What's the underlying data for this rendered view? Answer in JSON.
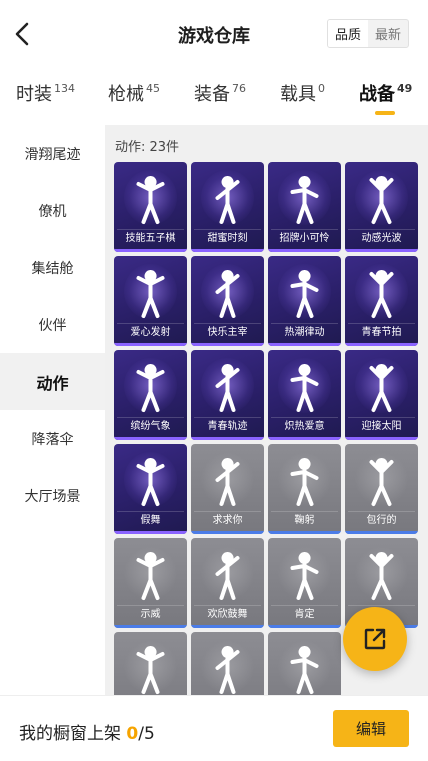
{
  "header": {
    "title": "游戏仓库",
    "sort_options": [
      "品质",
      "最新"
    ],
    "sort_active": "品质"
  },
  "tabs": [
    {
      "label": "时装",
      "count": "134"
    },
    {
      "label": "枪械",
      "count": "45"
    },
    {
      "label": "装备",
      "count": "76"
    },
    {
      "label": "载具",
      "count": "0"
    },
    {
      "label": "战备",
      "count": "49",
      "active": true
    }
  ],
  "sidebar": {
    "items": [
      "滑翔尾迹",
      "僚机",
      "集结舱",
      "伙伴",
      "动作",
      "降落伞",
      "大厅场景"
    ],
    "active": "动作"
  },
  "main": {
    "count_label": "动作: 23件",
    "items": [
      {
        "name": "技能五子棋",
        "tier": "purple"
      },
      {
        "name": "甜蜜时刻",
        "tier": "purple"
      },
      {
        "name": "招牌小可怜",
        "tier": "purple"
      },
      {
        "name": "动感光波",
        "tier": "purple"
      },
      {
        "name": "爱心发射",
        "tier": "purple"
      },
      {
        "name": "快乐主宰",
        "tier": "purple"
      },
      {
        "name": "热潮律动",
        "tier": "purple"
      },
      {
        "name": "青春节拍",
        "tier": "purple"
      },
      {
        "name": "缤纷气象",
        "tier": "purple"
      },
      {
        "name": "青春轨迹",
        "tier": "purple"
      },
      {
        "name": "炽热爱意",
        "tier": "purple"
      },
      {
        "name": "迎接太阳",
        "tier": "purple"
      },
      {
        "name": "假舞",
        "tier": "purple"
      },
      {
        "name": "求求你",
        "tier": "gray"
      },
      {
        "name": "鞠躬",
        "tier": "gray"
      },
      {
        "name": "包行的",
        "tier": "gray"
      },
      {
        "name": "示威",
        "tier": "gray"
      },
      {
        "name": "欢欣鼓舞",
        "tier": "gray"
      },
      {
        "name": "肯定",
        "tier": "gray"
      },
      {
        "name": "",
        "tier": "gray"
      },
      {
        "name": "",
        "tier": "gray"
      },
      {
        "name": "",
        "tier": "gray"
      },
      {
        "name": "",
        "tier": "gray"
      }
    ]
  },
  "fab": {
    "icon": "share-external-icon"
  },
  "bottom": {
    "shelf_label": "我的橱窗上架",
    "shelf_current": "0",
    "shelf_total": "/5",
    "edit_label": "编辑"
  },
  "colors": {
    "accent": "#f6b417",
    "purple_card": "#2a1f68",
    "gray_card": "#808086"
  }
}
